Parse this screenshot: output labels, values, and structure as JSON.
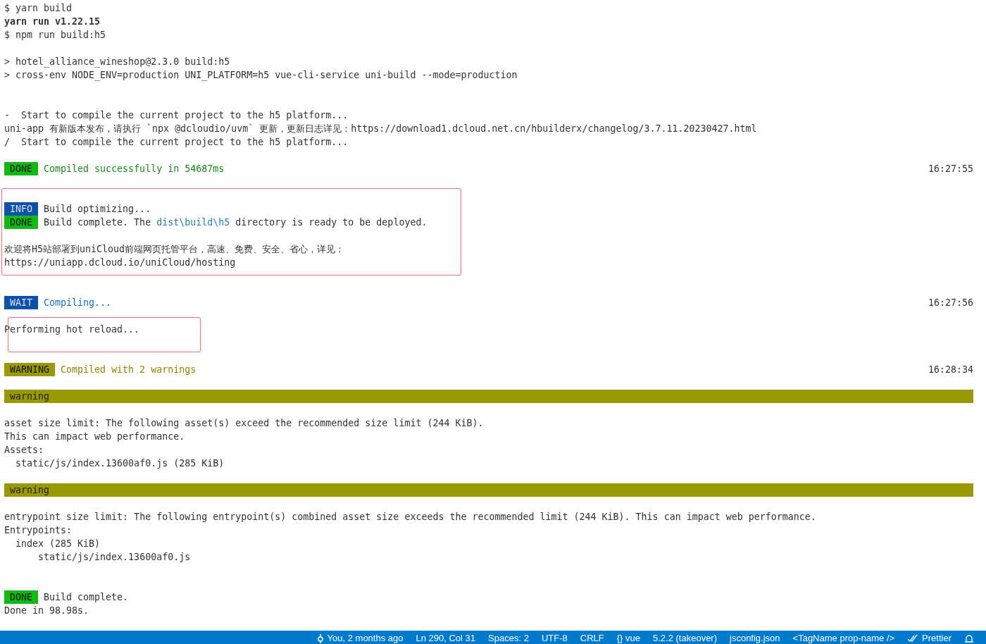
{
  "terminal": {
    "lines": [
      {
        "kind": "text",
        "segments": [
          {
            "text": "$ yarn build",
            "kind": "plain"
          }
        ]
      },
      {
        "kind": "text",
        "segments": [
          {
            "text": "yarn run v1.22.15",
            "kind": "bold"
          }
        ]
      },
      {
        "kind": "text",
        "segments": [
          {
            "text": "$ npm run build:h5",
            "kind": "plain"
          }
        ]
      },
      {
        "kind": "blank"
      },
      {
        "kind": "text",
        "segments": [
          {
            "text": "> hotel_alliance_wineshop@2.3.0 build:h5",
            "kind": "plain"
          }
        ]
      },
      {
        "kind": "text",
        "segments": [
          {
            "text": "> cross-env NODE_ENV=production UNI_PLATFORM=h5 vue-cli-service uni-build --mode=production",
            "kind": "plain"
          }
        ]
      },
      {
        "kind": "blank"
      },
      {
        "kind": "blank"
      },
      {
        "kind": "text",
        "segments": [
          {
            "text": "-  Start to compile the current project to the h5 platform...",
            "kind": "plain"
          }
        ]
      },
      {
        "kind": "text",
        "segments": [
          {
            "text": "uni-app 有新版本发布，请执行 `npx @dcloudio/uvm` 更新，更新日志详见：https://download1.dcloud.net.cn/hbuilderx/changelog/3.7.11.20230427.html",
            "kind": "plain"
          }
        ]
      },
      {
        "kind": "text",
        "segments": [
          {
            "text": "/  Start to compile the current project to the h5 platform...",
            "kind": "plain"
          }
        ]
      },
      {
        "kind": "blank"
      },
      {
        "kind": "tagged",
        "tag": {
          "kind": "done",
          "text": "DONE"
        },
        "segments": [
          {
            "text": "Compiled successfully in 54687ms",
            "kind": "success"
          }
        ],
        "time": "16:27:55"
      },
      {
        "kind": "blank"
      },
      {
        "kind": "blank"
      },
      {
        "kind": "tagged",
        "tag": {
          "kind": "info",
          "text": "INFO"
        },
        "segments": [
          {
            "text": "Build optimizing...",
            "kind": "plain"
          }
        ]
      },
      {
        "kind": "tagged",
        "tag": {
          "kind": "done",
          "text": "DONE"
        },
        "segments": [
          {
            "text": "Build complete. The ",
            "kind": "plain"
          },
          {
            "text": "dist\\build\\h5",
            "kind": "path"
          },
          {
            "text": " directory is ready to be deployed.",
            "kind": "plain"
          }
        ]
      },
      {
        "kind": "blank"
      },
      {
        "kind": "text",
        "segments": [
          {
            "text": "欢迎将H5站部署到uniCloud前端网页托管平台，高速、免费、安全、省心，详见：",
            "kind": "plain"
          }
        ]
      },
      {
        "kind": "text",
        "segments": [
          {
            "text": "https://uniapp.dcloud.io/uniCloud/hosting",
            "kind": "plain"
          }
        ]
      },
      {
        "kind": "blank"
      },
      {
        "kind": "blank"
      },
      {
        "kind": "tagged",
        "tag": {
          "kind": "wait",
          "text": "WAIT"
        },
        "segments": [
          {
            "text": "Compiling...",
            "kind": "progress"
          }
        ],
        "time": "16:27:56"
      },
      {
        "kind": "blank"
      },
      {
        "kind": "text",
        "segments": [
          {
            "text": "Performing hot reload...",
            "kind": "plain"
          }
        ]
      },
      {
        "kind": "blank"
      },
      {
        "kind": "blank"
      },
      {
        "kind": "tagged",
        "tag": {
          "kind": "warning",
          "text": "WARNING"
        },
        "segments": [
          {
            "text": "Compiled with 2 warnings",
            "kind": "warning"
          }
        ],
        "time": "16:28:34"
      },
      {
        "kind": "blank"
      },
      {
        "kind": "bar",
        "text": "warning"
      },
      {
        "kind": "blank"
      },
      {
        "kind": "text",
        "segments": [
          {
            "text": "asset size limit: The following asset(s) exceed the recommended size limit (244 KiB).",
            "kind": "plain"
          }
        ]
      },
      {
        "kind": "text",
        "segments": [
          {
            "text": "This can impact web performance.",
            "kind": "plain"
          }
        ]
      },
      {
        "kind": "text",
        "segments": [
          {
            "text": "Assets:",
            "kind": "plain"
          }
        ]
      },
      {
        "kind": "text",
        "segments": [
          {
            "text": "  static/js/index.13600af0.js (285 KiB)",
            "kind": "plain"
          }
        ]
      },
      {
        "kind": "blank"
      },
      {
        "kind": "bar",
        "text": "warning"
      },
      {
        "kind": "blank"
      },
      {
        "kind": "text",
        "segments": [
          {
            "text": "entrypoint size limit: The following entrypoint(s) combined asset size exceeds the recommended limit (244 KiB). This can impact web performance.",
            "kind": "plain"
          }
        ]
      },
      {
        "kind": "text",
        "segments": [
          {
            "text": "Entrypoints:",
            "kind": "plain"
          }
        ]
      },
      {
        "kind": "text",
        "segments": [
          {
            "text": "  index (285 KiB)",
            "kind": "plain"
          }
        ]
      },
      {
        "kind": "text",
        "segments": [
          {
            "text": "      static/js/index.13600af0.js",
            "kind": "plain"
          }
        ]
      },
      {
        "kind": "blank"
      },
      {
        "kind": "blank"
      },
      {
        "kind": "tagged",
        "tag": {
          "kind": "done",
          "text": "DONE"
        },
        "segments": [
          {
            "text": "Build complete.",
            "kind": "plain"
          }
        ]
      },
      {
        "kind": "text",
        "segments": [
          {
            "text": "Done in 98.98s.",
            "kind": "plain"
          }
        ]
      }
    ]
  },
  "status_bar": {
    "items": [
      {
        "kind": "commit",
        "text": "You, 2 months ago"
      },
      {
        "kind": "text",
        "text": "Ln 290, Col 31"
      },
      {
        "kind": "text",
        "text": "Spaces: 2"
      },
      {
        "kind": "text",
        "text": "UTF-8"
      },
      {
        "kind": "text",
        "text": "CRLF"
      },
      {
        "kind": "text",
        "text": "{} vue"
      },
      {
        "kind": "text",
        "text": "5.2.2 (takeover)"
      },
      {
        "kind": "text",
        "text": "jsconfig.json"
      },
      {
        "kind": "text",
        "text": "<TagName prop-name />"
      },
      {
        "kind": "formatter",
        "text": "Prettier"
      },
      {
        "kind": "notifications"
      }
    ]
  }
}
